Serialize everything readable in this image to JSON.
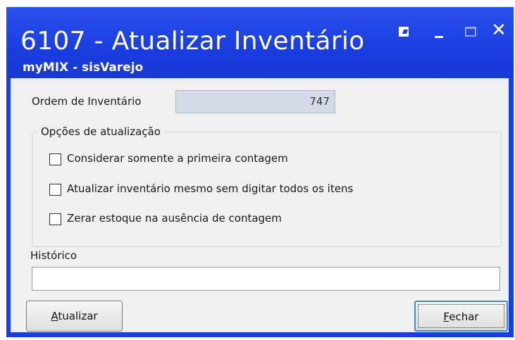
{
  "window": {
    "title": "6107 - Atualizar Inventário",
    "subtitle": "myMIX - sisVarejo",
    "controls": {
      "restore_icon": "window-restore-icon",
      "minimize_icon": "minimize-icon",
      "maximize_icon": "maximize-icon",
      "close_glyph": "✕"
    },
    "accent_color": "#1a3de0"
  },
  "form": {
    "order_label": "Ordem de Inventário",
    "order_value": "747",
    "options_group_title": "Opções de atualização",
    "options": [
      {
        "label": "Considerar somente a primeira contagem",
        "checked": false
      },
      {
        "label": "Atualizar inventário mesmo sem digitar todos os itens",
        "checked": false
      },
      {
        "label": "Zerar estoque na ausência de contagem",
        "checked": false
      }
    ],
    "history_label": "Histórico",
    "history_value": ""
  },
  "buttons": {
    "update_accel": "A",
    "update_rest": "tualizar",
    "close_accel": "F",
    "close_rest": "echar"
  }
}
